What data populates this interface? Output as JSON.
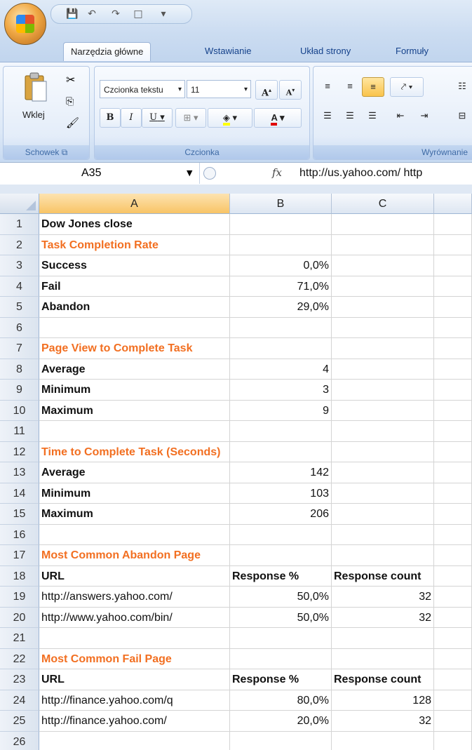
{
  "ribbon": {
    "tabs": [
      "Narzędzia główne",
      "Wstawianie",
      "Układ strony",
      "Formuły"
    ],
    "paste_label": "Wklej",
    "font_name": "Czcionka tekstu",
    "font_size": "11",
    "groups": [
      "Schowek",
      "Czcionka",
      "Wyrównanie"
    ],
    "bold": "B",
    "italic": "I",
    "underline": "U",
    "grow_font": "A",
    "shrink_font": "A",
    "font_color": "A"
  },
  "formula_bar": {
    "cell_ref": "A35",
    "fx": "fx",
    "content": "http://us.yahoo.com/ http"
  },
  "columns": [
    "A",
    "B",
    "C"
  ],
  "rows": [
    {
      "n": "1",
      "a": "Dow Jones close",
      "b": "",
      "c": "",
      "style": "bold"
    },
    {
      "n": "2",
      "a": "Task Completion Rate",
      "b": "",
      "c": "",
      "style": "orange"
    },
    {
      "n": "3",
      "a": "Success",
      "b": "0,0%",
      "c": "",
      "style": "bold"
    },
    {
      "n": "4",
      "a": "Fail",
      "b": "71,0%",
      "c": "",
      "style": "bold"
    },
    {
      "n": "5",
      "a": "Abandon",
      "b": "29,0%",
      "c": "",
      "style": "bold"
    },
    {
      "n": "6",
      "a": "",
      "b": "",
      "c": "",
      "style": ""
    },
    {
      "n": "7",
      "a": "Page View to Complete Task",
      "b": "",
      "c": "",
      "style": "orange"
    },
    {
      "n": "8",
      "a": "Average",
      "b": "4",
      "c": "",
      "style": "bold"
    },
    {
      "n": "9",
      "a": "Minimum",
      "b": "3",
      "c": "",
      "style": "bold"
    },
    {
      "n": "10",
      "a": "Maximum",
      "b": "9",
      "c": "",
      "style": "bold"
    },
    {
      "n": "11",
      "a": "",
      "b": "",
      "c": "",
      "style": ""
    },
    {
      "n": "12",
      "a": "Time to Complete Task (Seconds)",
      "b": "",
      "c": "",
      "style": "orange"
    },
    {
      "n": "13",
      "a": "Average",
      "b": "142",
      "c": "",
      "style": "bold"
    },
    {
      "n": "14",
      "a": "Minimum",
      "b": "103",
      "c": "",
      "style": "bold"
    },
    {
      "n": "15",
      "a": "Maximum",
      "b": "206",
      "c": "",
      "style": "bold"
    },
    {
      "n": "16",
      "a": "",
      "b": "",
      "c": "",
      "style": ""
    },
    {
      "n": "17",
      "a": "Most Common Abandon Page",
      "b": "",
      "c": "",
      "style": "orange"
    },
    {
      "n": "18",
      "a": "URL",
      "b": "Response %",
      "c": "Response count",
      "style": "header"
    },
    {
      "n": "19",
      "a": "http://answers.yahoo.com/",
      "b": "50,0%",
      "c": "32",
      "style": ""
    },
    {
      "n": "20",
      "a": "http://www.yahoo.com/bin/",
      "b": "50,0%",
      "c": "32",
      "style": ""
    },
    {
      "n": "21",
      "a": "",
      "b": "",
      "c": "",
      "style": ""
    },
    {
      "n": "22",
      "a": "Most Common Fail Page",
      "b": "",
      "c": "",
      "style": "orange"
    },
    {
      "n": "23",
      "a": "URL",
      "b": "Response %",
      "c": "Response count",
      "style": "header"
    },
    {
      "n": "24",
      "a": "http://finance.yahoo.com/q",
      "b": "80,0%",
      "c": "128",
      "style": ""
    },
    {
      "n": "25",
      "a": "http://finance.yahoo.com/",
      "b": "20,0%",
      "c": "32",
      "style": ""
    },
    {
      "n": "26",
      "a": "",
      "b": "",
      "c": "",
      "style": ""
    }
  ],
  "colors": {
    "section_title": "#f26f21",
    "selected_header": "#f8c466"
  }
}
